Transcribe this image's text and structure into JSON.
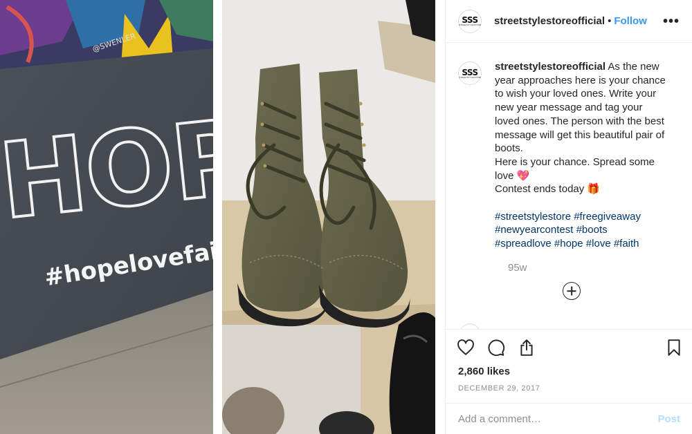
{
  "post": {
    "username": "streetstylestoreofficial",
    "separator": "•",
    "follow_label": "Follow",
    "more_label": "•••",
    "avatar_logo": "SSS",
    "avatar_logo_sub": "STREETSTYLESTORE",
    "caption_lines": [
      "As the new",
      "year approaches here is your chance",
      "to wish your loved ones. Write your",
      "new year message and tag your",
      "loved ones. The person with the best",
      "message will get this beautiful pair of",
      "boots.",
      "Here is your chance. Spread some",
      "love 💖",
      "Contest ends today 🎁"
    ],
    "hashtag_lines": [
      [
        "#streetstylestore",
        "#freegiveaway"
      ],
      [
        "#newyearcontest",
        "#boots"
      ],
      [
        "#spreadlove",
        "#hope",
        "#love",
        "#faith"
      ]
    ],
    "time_ago": "95w",
    "likes": "2,860 likes",
    "date": "DECEMBER 29, 2017",
    "comment_placeholder": "Add a comment…",
    "post_label": "Post"
  },
  "images": {
    "left": {
      "wall_text": "HOPE",
      "hashtag_text": "#hopelovefaith",
      "tag_text": "@SWENLER"
    },
    "right": {
      "subject": "olive suede lace-up boots"
    }
  },
  "icons": [
    "heart-icon",
    "comment-icon",
    "share-icon",
    "bookmark-icon",
    "add-circle-icon",
    "more-options-icon"
  ],
  "colors": {
    "follow": "#3897f0",
    "hashtag": "#003569",
    "muted": "#8e8e8e",
    "post_disabled": "#b2dffc",
    "border": "#efefef",
    "text": "#262626"
  }
}
